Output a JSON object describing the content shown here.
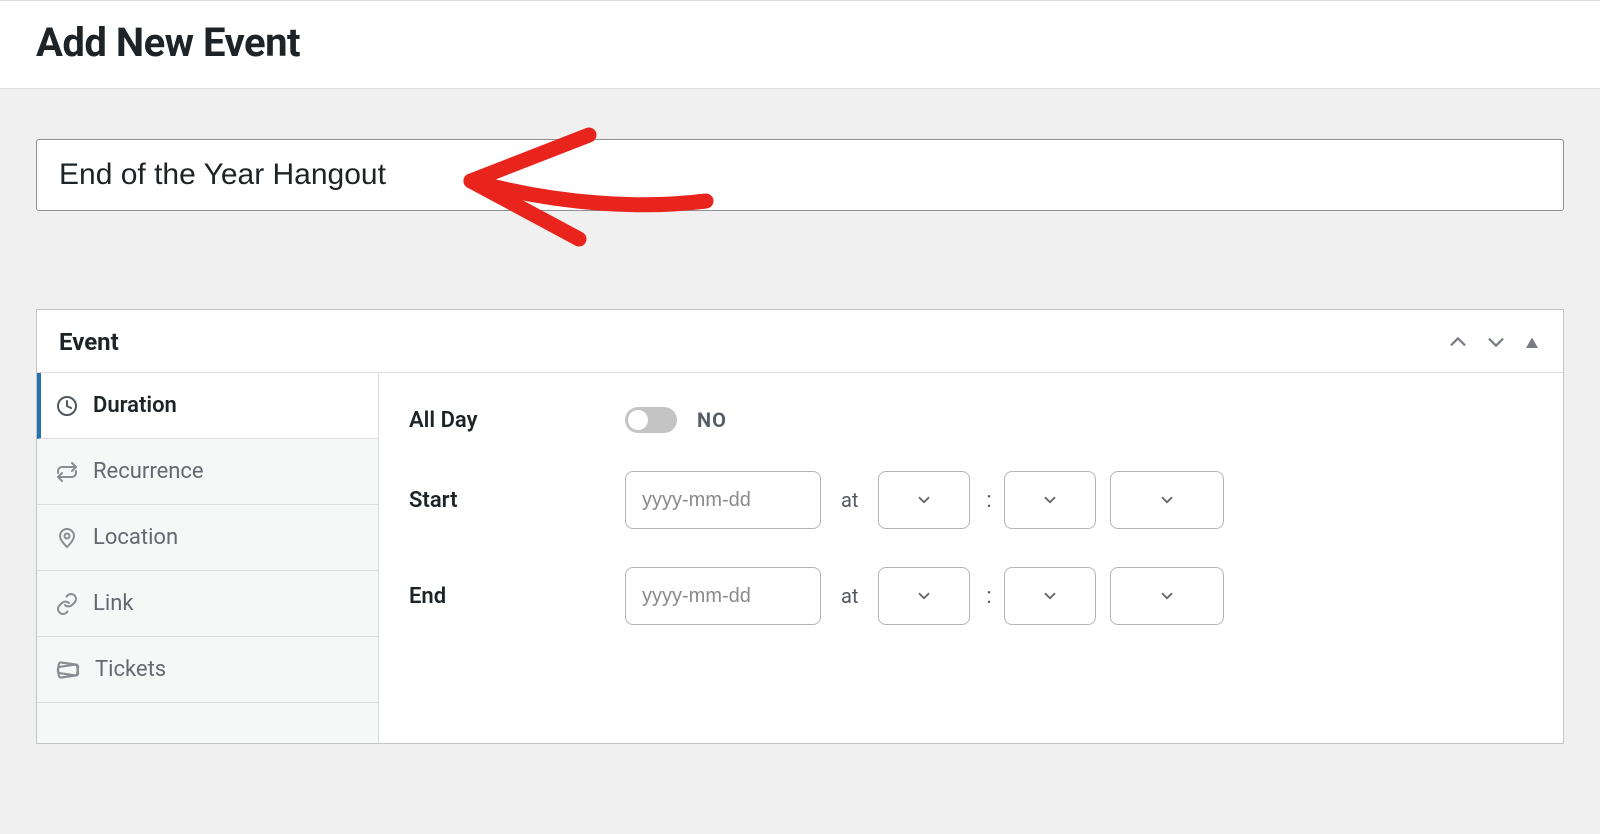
{
  "header": {
    "title": "Add New Event"
  },
  "title_input": {
    "value": "End of the Year Hangout"
  },
  "panel": {
    "title": "Event",
    "tabs": [
      {
        "label": "Duration"
      },
      {
        "label": "Recurrence"
      },
      {
        "label": "Location"
      },
      {
        "label": "Link"
      },
      {
        "label": "Tickets"
      }
    ]
  },
  "duration": {
    "all_day_label": "All Day",
    "all_day_value": "NO",
    "start_label": "Start",
    "end_label": "End",
    "date_placeholder": "yyyy-mm-dd",
    "at_label": "at",
    "colon": ":"
  }
}
